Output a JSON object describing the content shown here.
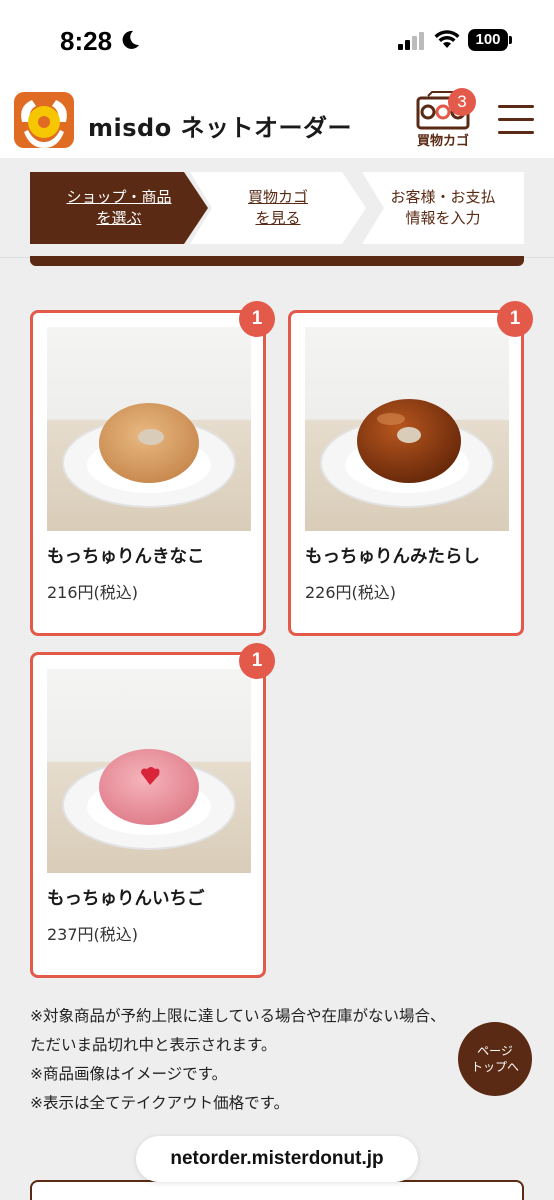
{
  "status_bar": {
    "time": "8:28",
    "battery": "100"
  },
  "header": {
    "brand": "misdo ネットオーダー",
    "cart_label": "買物カゴ",
    "cart_count": "3",
    "icons": [
      "logo-icon",
      "cart-icon",
      "menu-icon"
    ]
  },
  "steps": [
    {
      "line1": "ショップ・商品",
      "line2": "を選ぶ",
      "active": true
    },
    {
      "line1": "買物カゴ",
      "line2": "を見る",
      "active": false
    },
    {
      "line1": "お客様・お支払",
      "line2": "情報を入力",
      "active": false
    }
  ],
  "products": [
    {
      "name": "もっちゅりんきなこ",
      "price": "216円(税込)",
      "quantity": "1",
      "color": "#d9a66b"
    },
    {
      "name": "もっちゅりんみたらし",
      "price": "226円(税込)",
      "quantity": "1",
      "color": "#8a3e14"
    },
    {
      "name": "もっちゅりんいちご",
      "price": "237円(税込)",
      "quantity": "1",
      "color": "#e8909a"
    }
  ],
  "notes": [
    "※対象商品が予約上限に達している場合や在庫がない場合、",
    "ただいま品切れ中と表示されます。",
    "※商品画像はイメージです。",
    "※表示は全てテイクアウト価格です。"
  ],
  "page_top": {
    "line1": "ページ",
    "line2": "トップへ"
  },
  "url": "netorder.misterdonut.jp",
  "colors": {
    "brand_brown": "#5a2a14",
    "accent_red": "#e3594a",
    "logo_orange": "#e06c23"
  }
}
